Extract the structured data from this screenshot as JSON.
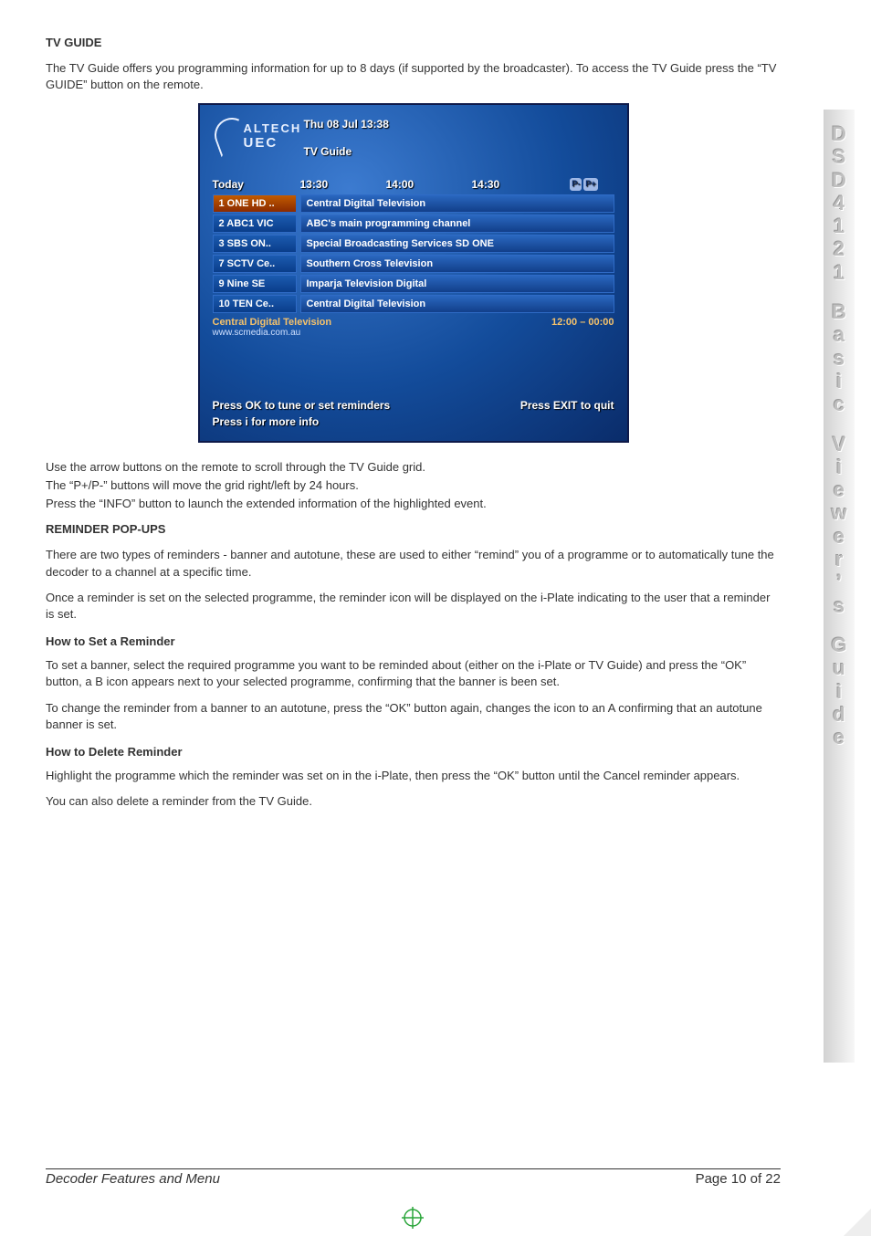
{
  "doc": {
    "tv_guide_heading": "TV GUIDE",
    "tv_guide_intro": "The TV Guide offers you programming information for up to 8 days (if supported by the broadcaster).  To access the TV Guide press the “TV GUIDE” button on the remote.",
    "tv_guide_use1": "Use the arrow buttons on the remote to scroll through the TV Guide grid.",
    "tv_guide_use2": "The “P+/P-” buttons will move the grid right/left by 24 hours.",
    "tv_guide_use3": "Press the “INFO” button to launch the extended information of the highlighted event.",
    "reminder_heading": "REMINDER POP-UPS",
    "reminder_p1": "There are two types of reminders - banner and autotune, these are used to either “remind” you of a programme or to automatically tune the decoder to a channel at a specific time.",
    "reminder_p2": "Once a reminder is set on the selected programme, the reminder icon will be displayed on the i-Plate indicating to the user that a reminder is set.",
    "howset_heading": "How to Set a Reminder",
    "howset_p1": "To set a banner, select the required programme you want to be reminded about (either on the i-Plate or TV Guide) and press the “OK” button, a B icon appears next to your selected programme, confirming that the banner is been set.",
    "howset_p2": "To change the reminder from a banner to an autotune, press the “OK” button again, changes the icon to an A confirming that an autotune banner is set.",
    "howdel_heading": "How to Delete Reminder",
    "howdel_p1": "Highlight the programme which the reminder was set on in the i-Plate, then press the “OK” button until the Cancel reminder appears.",
    "howdel_p2": "You can also delete a reminder from the TV Guide."
  },
  "tv": {
    "logo_top": "ALTECH",
    "logo_bottom": "UEC",
    "datetime": "Thu 08 Jul 13:38",
    "title": "TV Guide",
    "day": "Today",
    "times": [
      "13:30",
      "14:00",
      "14:30"
    ],
    "p_minus": "P-",
    "p_plus": "P+",
    "rows": [
      {
        "ch": "1 ONE HD ..",
        "ev": "Central Digital Television"
      },
      {
        "ch": "2 ABC1 VIC",
        "ev": "ABC's main programming channel"
      },
      {
        "ch": "3 SBS ON..",
        "ev": "Special Broadcasting Services SD ONE"
      },
      {
        "ch": "7 SCTV Ce..",
        "ev": "Southern Cross Television"
      },
      {
        "ch": "9 Nine SE",
        "ev": "Imparja Television Digital"
      },
      {
        "ch": "10 TEN Ce..",
        "ev": "Central Digital Television"
      }
    ],
    "info_title": "Central Digital Television",
    "info_time": "12:00 – 00:00",
    "info_url": "www.scmedia.com.au",
    "foot_ok": "Press OK to tune or set reminders",
    "foot_exit": "Press EXIT to quit",
    "foot_i": "Press i for more info"
  },
  "side": {
    "chars": [
      "D",
      "S",
      "D",
      "4",
      "1",
      "2",
      "1",
      "",
      "B",
      "a",
      "s",
      "i",
      "c",
      "",
      "V",
      "i",
      "e",
      "w",
      "e",
      "r",
      "’",
      "s",
      "",
      "G",
      "u",
      "i",
      "d",
      "e"
    ]
  },
  "footer": {
    "left": "Decoder Features and Menu",
    "right": "Page 10 of 22"
  }
}
